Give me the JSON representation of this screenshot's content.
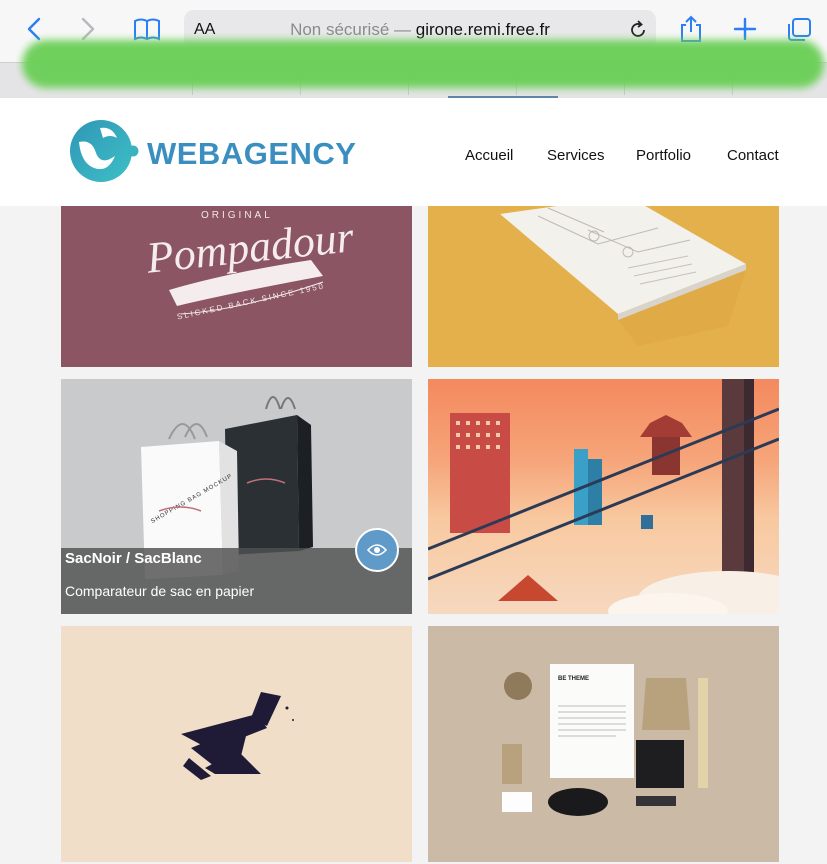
{
  "browser": {
    "text_size_label": "AA",
    "security_label": "Non sécurisé",
    "separator": "—",
    "domain": "girone.remi.free.fr"
  },
  "site": {
    "brand": "WEBAGENCY",
    "brand_color": "#3a8fc0",
    "nav": [
      "Accueil",
      "Services",
      "Portfolio",
      "Contact"
    ]
  },
  "portfolio": {
    "pompadour": {
      "script": "Pompadour",
      "top": "ORIGINAL",
      "ribbon": "SLICKED BACK SINCE 1950"
    },
    "bags": {
      "title": "SacNoir / SacBlanc",
      "subtitle": "Comparateur de sac en papier",
      "bag_text": "SHOPPING BAG MOCKUP"
    },
    "stationery": {
      "brand": "BE THEME"
    }
  },
  "colors": {
    "accent": "#2a7ff5",
    "overlay_button": "#5f9ac8"
  }
}
